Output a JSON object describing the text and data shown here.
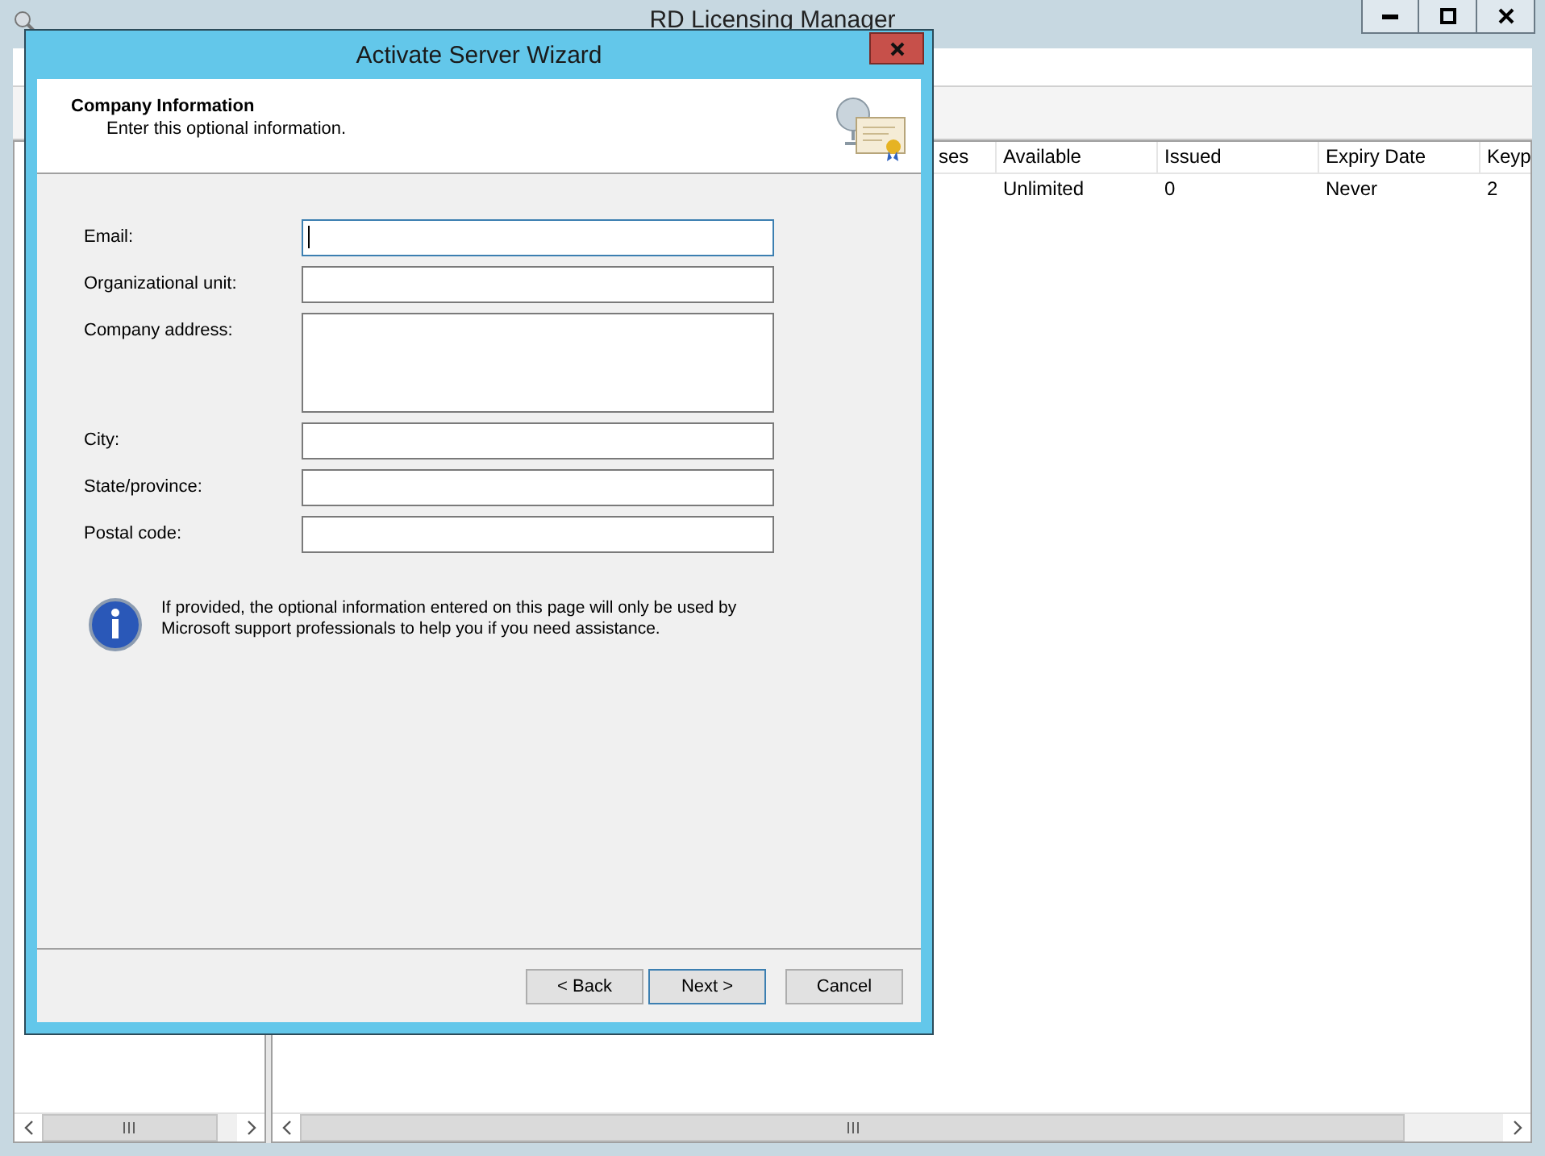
{
  "main_window": {
    "title": "RD Licensing Manager",
    "columns": [
      "ses",
      "Available",
      "Issued",
      "Expiry Date",
      "Keyp"
    ],
    "rows": [
      [
        "",
        "Unlimited",
        "0",
        "Never",
        "2"
      ]
    ]
  },
  "dialog": {
    "title": "Activate Server Wizard",
    "heading": "Company Information",
    "subheading": "Enter this optional information.",
    "fields": [
      {
        "label": "Email:",
        "kind": "line",
        "focused": true
      },
      {
        "label": "Organizational unit:",
        "kind": "line",
        "focused": false
      },
      {
        "label": "Company address:",
        "kind": "area",
        "focused": false
      },
      {
        "label": "City:",
        "kind": "line",
        "focused": false
      },
      {
        "label": "State/province:",
        "kind": "line",
        "focused": false
      },
      {
        "label": "Postal code:",
        "kind": "line",
        "focused": false
      }
    ],
    "info": "If provided, the optional information entered on this page will only be used by Microsoft support professionals to help you if you need assistance.",
    "buttons": [
      {
        "label": "< Back",
        "default": false
      },
      {
        "label": "Next >",
        "default": true
      },
      {
        "label": "Cancel",
        "default": false
      }
    ]
  }
}
